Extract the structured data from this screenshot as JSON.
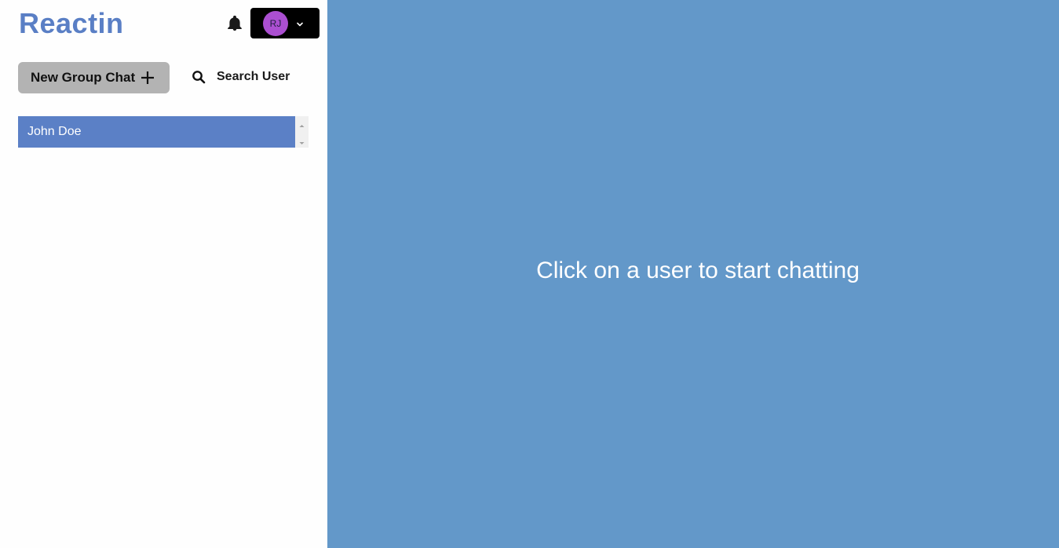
{
  "header": {
    "brand": "Reactin",
    "notifications_icon": "bell-icon",
    "user_menu": {
      "initials": "RJ",
      "avatar_color": "#ab4fd1",
      "caret_icon": "chevron-down-icon"
    }
  },
  "sidebar": {
    "new_group_label": "New Group Chat",
    "new_group_icon": "plus-icon",
    "search_label": "Search User",
    "search_icon": "search-icon",
    "chats": [
      {
        "name": "John Doe",
        "selected": true
      }
    ]
  },
  "main": {
    "placeholder": "Click on a user to start chatting"
  },
  "colors": {
    "brand": "#5a7fc5",
    "selected_chat": "#5b80c6",
    "chat_area": "#6398c9",
    "button_bg": "#b3b3b3",
    "user_menu_bg": "#000000"
  }
}
